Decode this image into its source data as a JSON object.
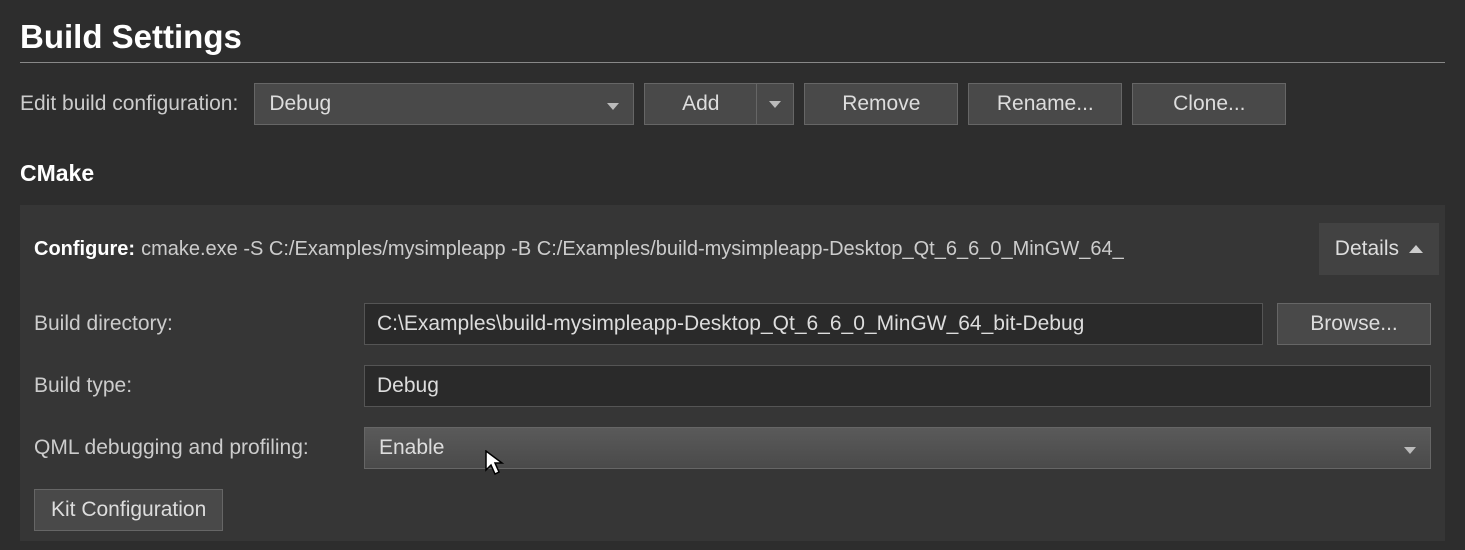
{
  "page": {
    "title": "Build Settings"
  },
  "config_row": {
    "label": "Edit build configuration:",
    "selected": "Debug",
    "add_label": "Add",
    "remove_label": "Remove",
    "rename_label": "Rename...",
    "clone_label": "Clone..."
  },
  "cmake": {
    "section_title": "CMake",
    "configure_label": "Configure:",
    "configure_cmd": "cmake.exe -S C:/Examples/mysimpleapp -B C:/Examples/build-mysimpleapp-Desktop_Qt_6_6_0_MinGW_64_",
    "details_label": "Details",
    "build_dir_label": "Build directory:",
    "build_dir_value": "C:\\Examples\\build-mysimpleapp-Desktop_Qt_6_6_0_MinGW_64_bit-Debug",
    "browse_label": "Browse...",
    "build_type_label": "Build type:",
    "build_type_value": "Debug",
    "qml_label": "QML debugging and profiling:",
    "qml_value": "Enable",
    "kit_config_label": "Kit Configuration"
  }
}
